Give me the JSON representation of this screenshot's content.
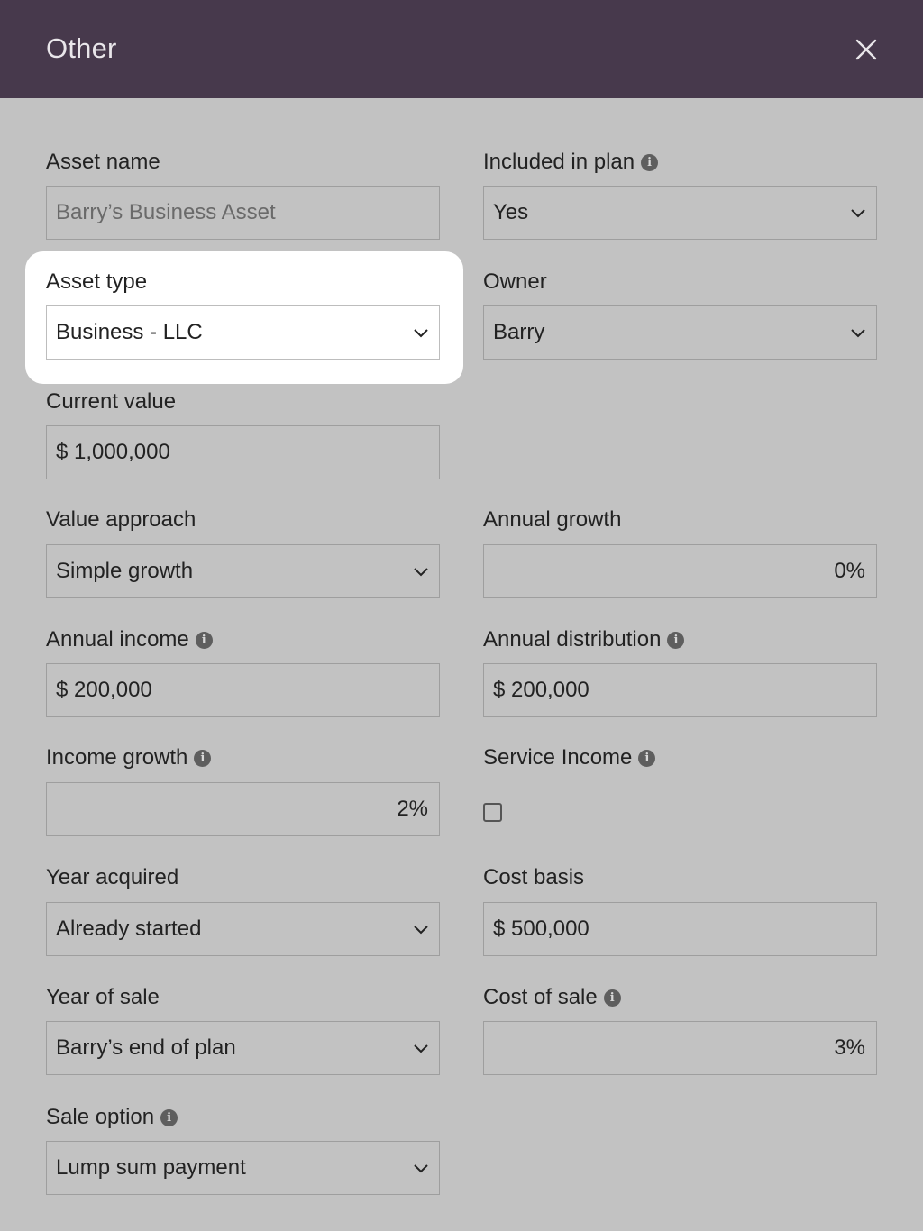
{
  "header": {
    "title": "Other",
    "close_icon": "close-icon"
  },
  "colors": {
    "header_bg": "#47394c",
    "page_bg": "#c2c2c2",
    "highlight_bg": "#ffffff"
  },
  "fields": {
    "asset_name": {
      "label": "Asset name",
      "placeholder": "Barry’s Business Asset"
    },
    "included_in_plan": {
      "label": "Included in plan",
      "value": "Yes"
    },
    "asset_type": {
      "label": "Asset type",
      "value": "Business - LLC"
    },
    "owner": {
      "label": "Owner",
      "value": "Barry"
    },
    "current_value": {
      "label": "Current value",
      "value": "$ 1,000,000"
    },
    "value_approach": {
      "label": "Value approach",
      "value": "Simple growth"
    },
    "annual_growth": {
      "label": "Annual growth",
      "value": "0%"
    },
    "annual_income": {
      "label": "Annual income",
      "value": "$ 200,000"
    },
    "annual_distribution": {
      "label": "Annual distribution",
      "value": "$ 200,000"
    },
    "income_growth": {
      "label": "Income growth",
      "value": "2%"
    },
    "service_income": {
      "label": "Service Income",
      "checked": false
    },
    "year_acquired": {
      "label": "Year acquired",
      "value": "Already started"
    },
    "cost_basis": {
      "label": "Cost basis",
      "value": "$ 500,000"
    },
    "year_of_sale": {
      "label": "Year of sale",
      "value": "Barry’s end of plan"
    },
    "cost_of_sale": {
      "label": "Cost of sale",
      "value": "3%"
    },
    "sale_option": {
      "label": "Sale option",
      "value": "Lump sum payment"
    }
  }
}
